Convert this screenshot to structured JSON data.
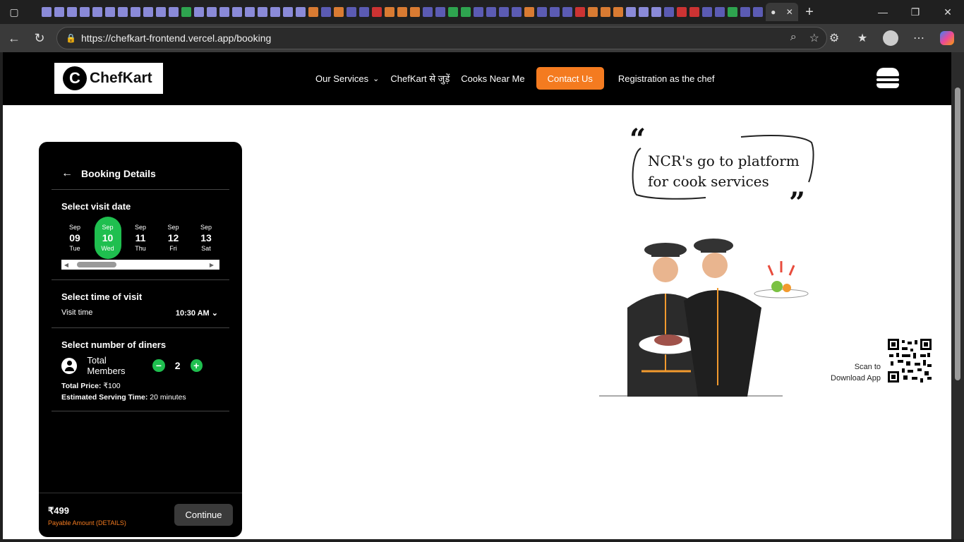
{
  "browser": {
    "url": "https://chefkart-frontend.vercel.app/booking"
  },
  "header": {
    "logo_text": "ChefKart",
    "nav": {
      "services": "Our Services",
      "join": "ChefKart से जुड़ें",
      "cooks": "Cooks Near Me",
      "contact": "Contact Us",
      "register": "Registration as the chef"
    }
  },
  "booking": {
    "title": "Booking Details",
    "date_section": "Select visit date",
    "dates": [
      {
        "month": "Sep",
        "day": "09",
        "weekday": "Tue"
      },
      {
        "month": "Sep",
        "day": "10",
        "weekday": "Wed"
      },
      {
        "month": "Sep",
        "day": "11",
        "weekday": "Thu"
      },
      {
        "month": "Sep",
        "day": "12",
        "weekday": "Fri"
      },
      {
        "month": "Sep",
        "day": "13",
        "weekday": "Sat"
      }
    ],
    "selected_date_index": 1,
    "time_section": "Select time of visit",
    "visit_time_label": "Visit time",
    "visit_time_value": "10:30 AM",
    "diners_section": "Select number of diners",
    "members_label": "Total Members",
    "members_count": "2",
    "total_price_label": "Total Price:",
    "total_price_value": "₹100",
    "serving_time_label": "Estimated Serving Time:",
    "serving_time_value": "20 minutes",
    "payable_price": "₹499",
    "payable_label": "Payable Amount (DETAILS)",
    "continue_label": "Continue"
  },
  "hero": {
    "tagline_line1": "NCR's go to platform",
    "tagline_line2": "for cook services",
    "scan_line1": "Scan to",
    "scan_line2": "Download App"
  },
  "colors": {
    "accent_orange": "#f47b20",
    "accent_green": "#1fbf4f",
    "panel_bg": "#000000"
  }
}
